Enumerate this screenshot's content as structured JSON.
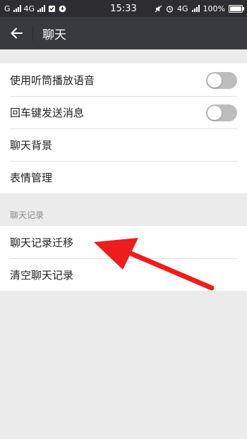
{
  "status_bar": {
    "carrier1": "G",
    "carrier2": "4G",
    "time": "15:33",
    "network": "4G",
    "battery": "100%",
    "battery_level": 1.0
  },
  "header": {
    "title": "聊天",
    "back_icon": "arrow-left-icon"
  },
  "settings": {
    "items": [
      {
        "label": "使用听筒播放语音",
        "toggle": false
      },
      {
        "label": "回车键发送消息",
        "toggle": false
      },
      {
        "label": "聊天背景"
      },
      {
        "label": "表情管理"
      }
    ]
  },
  "history": {
    "section_label": "聊天记录",
    "items": [
      {
        "label": "聊天记录迁移"
      },
      {
        "label": "清空聊天记录"
      }
    ]
  },
  "colors": {
    "status_bar_bg": "#2e2e32",
    "title_bar_bg": "#393a3f",
    "page_bg": "#ebebeb",
    "annotation_arrow": "#ee1c1c"
  }
}
